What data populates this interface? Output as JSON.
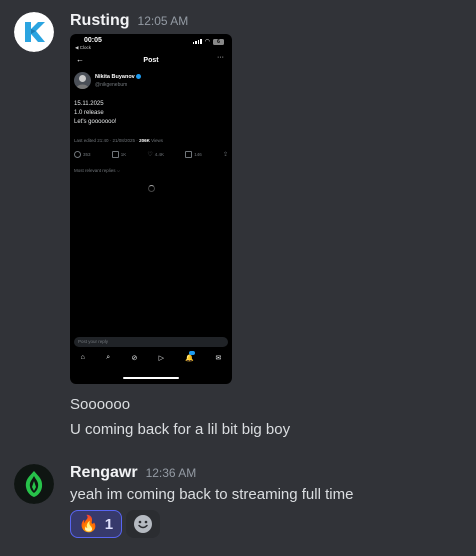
{
  "messages": [
    {
      "username": "Rusting",
      "timestamp": "12:05 AM",
      "lines": [
        "Soooooo",
        "U coming back for a lil bit big boy"
      ]
    },
    {
      "username": "Rengawr",
      "timestamp": "12:36 AM",
      "lines": [
        "yeah im coming back to streaming full time"
      ],
      "reactions": [
        {
          "emoji": "🔥",
          "count": "1"
        }
      ]
    }
  ],
  "embedded_screenshot": {
    "status_time": "00:05",
    "status_back": "◀ Clock",
    "battery": "6",
    "nav_title": "Post",
    "author_name": "Nikita Buyanov",
    "author_handle": "@nikgenebum",
    "post_lines": [
      "15.11.2025",
      "1.0 release",
      "Let's gooooooo!"
    ],
    "edited_prefix": "Last edited 21:40 · 21/08/2025 ·",
    "views_count": "206K",
    "views_label": "Views",
    "action_counts": {
      "replies": "353",
      "reposts": "1K",
      "likes": "4.4K",
      "bookmarks": "146"
    },
    "relevant_label": "Most relevant replies ⌵",
    "reply_placeholder": "Post your reply"
  },
  "colors": {
    "background": "#313338",
    "username": "#f2f3f5",
    "timestamp": "#949ba4",
    "reaction_active_bg": "#373a6c",
    "reaction_active_border": "#5865f2",
    "rengawr_avatar_green": "#27c24a"
  }
}
